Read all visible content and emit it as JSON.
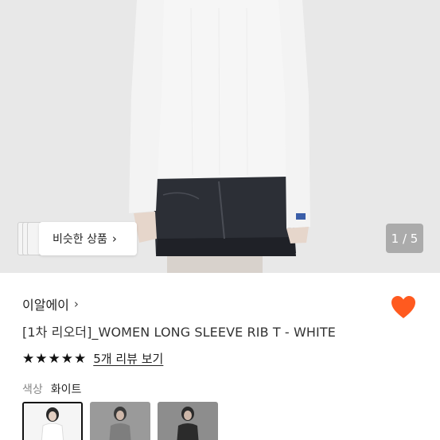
{
  "gallery": {
    "similar_label": "비슷한 상품",
    "chevron": "›",
    "pager": "1 / 5"
  },
  "product": {
    "brand": "이알에이",
    "brand_chevron": "›",
    "title": "[1차 리오더]_WOMEN LONG SLEEVE RIB T - WHITE",
    "rating_stars": 5,
    "review_link": "5개 리뷰 보기",
    "color_label": "색상",
    "color_value": "화이트",
    "wishlist_icon": "heart-icon",
    "accent_color": "#ff5a1f"
  }
}
